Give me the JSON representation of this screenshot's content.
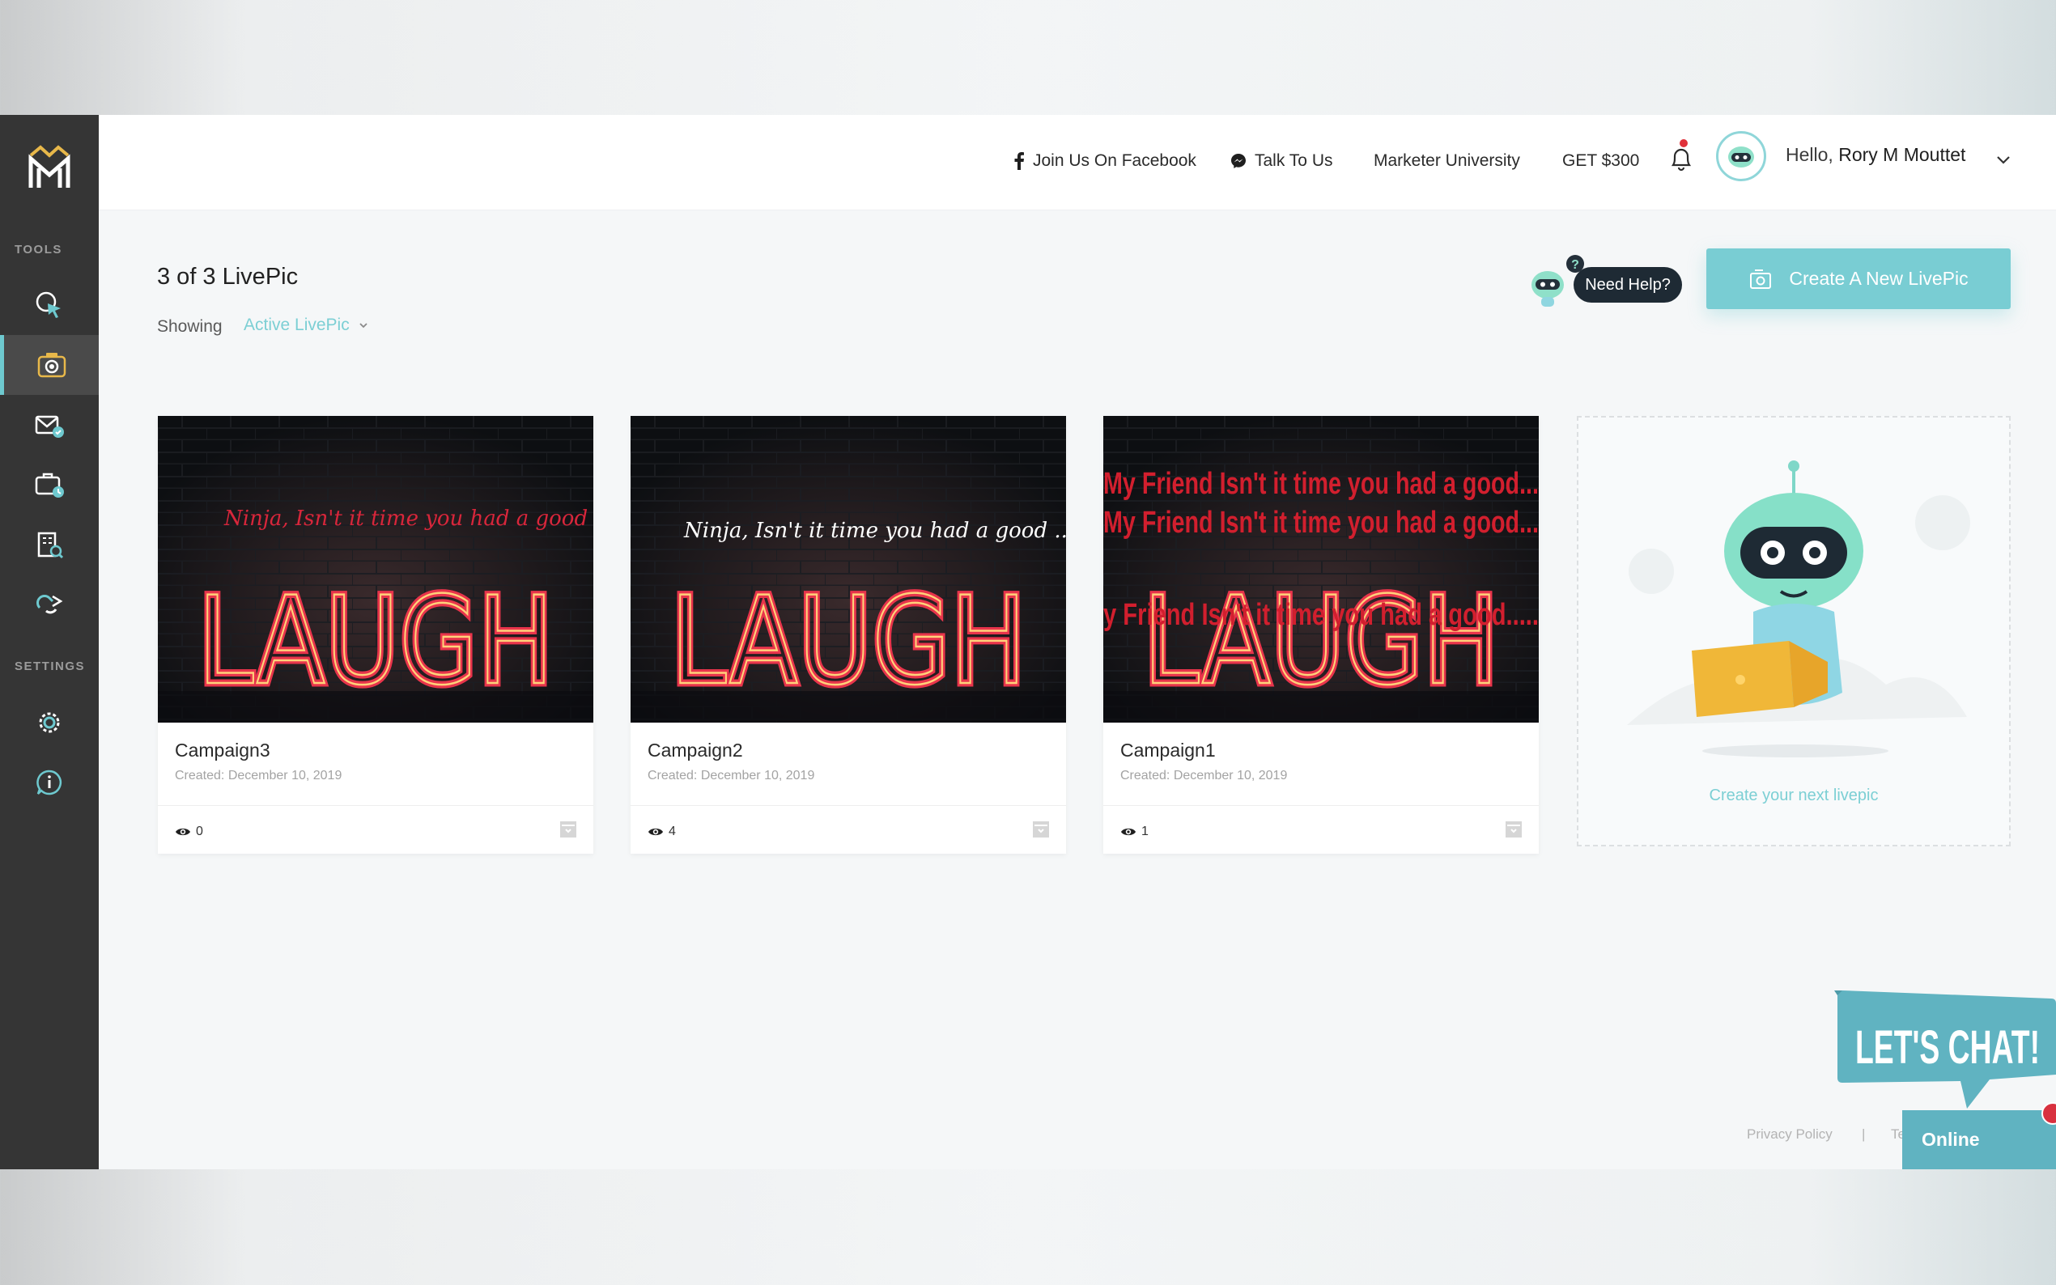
{
  "header": {
    "links": [
      {
        "label": "Join Us On Facebook",
        "icon": "facebook-icon"
      },
      {
        "label": "Talk To Us",
        "icon": "messenger-icon"
      },
      {
        "label": "Marketer University"
      },
      {
        "label": "GET $300"
      }
    ],
    "greeting": "Hello,",
    "user_name": "Rory M Mouttet"
  },
  "sidebar": {
    "tools_label": "TOOLS",
    "settings_label": "SETTINGS",
    "accent": "#6ec9cf"
  },
  "main": {
    "title": "3 of 3 LivePic",
    "showing_label": "Showing",
    "filter_value": "Active LivePic",
    "need_help": "Need Help?",
    "create_button": "Create A New LivePic",
    "cards": [
      {
        "name": "Campaign3",
        "created": "Created: December 10, 2019",
        "views": "0",
        "overlay_text": "Ninja, Isn't it time you had a good .....",
        "sign": "LAUGH"
      },
      {
        "name": "Campaign2",
        "created": "Created: December 10, 2019",
        "views": "4",
        "overlay_text": "Ninja, Isn't it time you had a good .....",
        "sign": "LAUGH"
      },
      {
        "name": "Campaign1",
        "created": "Created: December 10, 2019",
        "views": "1",
        "overlay_lines": [
          "My Friend Isn't it time you had a good...",
          "My Friend Isn't it time you had a good...",
          "y Friend Isn't it time you had a good....."
        ],
        "sign": "LAUGH"
      }
    ],
    "next_card_label": "Create your next livepic"
  },
  "footer": {
    "privacy": "Privacy Policy",
    "separator": "|",
    "terms_fragment": "Te"
  },
  "chat": {
    "bubble_text": "LET'S CHAT!",
    "status": "Online"
  }
}
